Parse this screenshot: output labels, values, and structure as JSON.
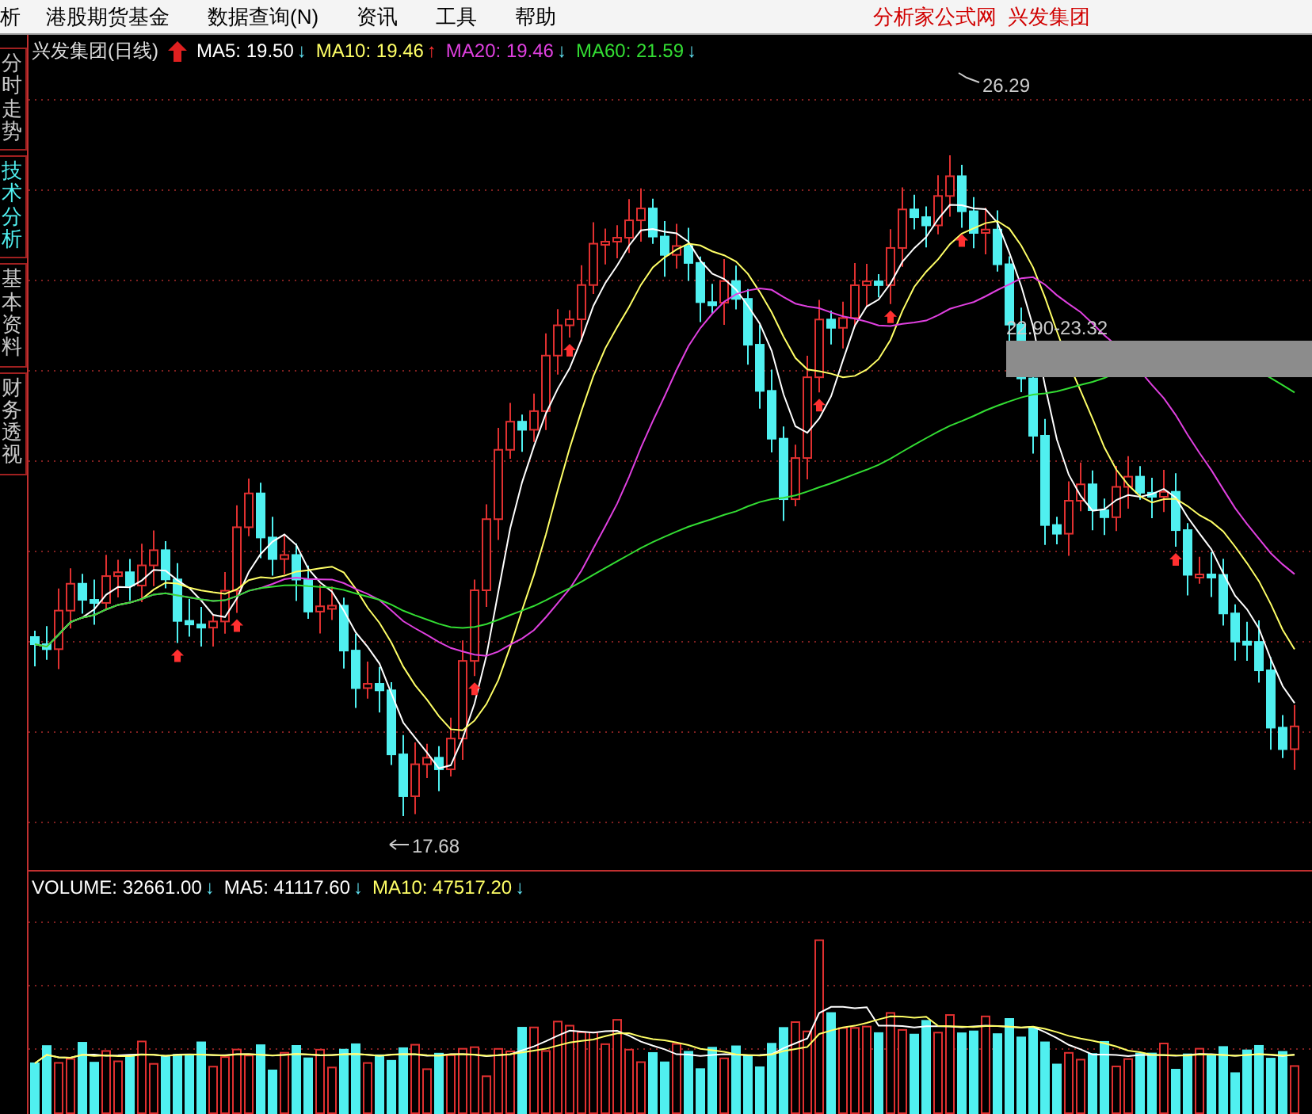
{
  "menu_bar": {
    "items": [
      {
        "label": "析"
      },
      {
        "label": "港股期货基金"
      },
      {
        "label": "数据查询(N)"
      },
      {
        "label": "资讯"
      },
      {
        "label": "工具"
      },
      {
        "label": "帮助"
      }
    ],
    "right_text": "分析家公式网  兴发集团"
  },
  "side_tabs": [
    {
      "label": "分时走势",
      "selected": false
    },
    {
      "label": "技术分析",
      "selected": true
    },
    {
      "label": "基本资料",
      "selected": false
    },
    {
      "label": "财务透视",
      "selected": false
    }
  ],
  "price_panel": {
    "title": "兴发集团(日线)",
    "indicators": [
      {
        "name": "MA5:",
        "value": "19.50",
        "arrow": "↓",
        "rising": false,
        "color": "#ffffff"
      },
      {
        "name": "MA10:",
        "value": "19.46",
        "arrow": "↑",
        "rising": true,
        "color": "#ffff66"
      },
      {
        "name": "MA20:",
        "value": "19.46",
        "arrow": "↓",
        "rising": false,
        "color": "#e040e0"
      },
      {
        "name": "MA60:",
        "value": "21.59",
        "arrow": "↓",
        "rising": false,
        "color": "#33dd33"
      }
    ],
    "high_label": "26.29",
    "low_label": "17.68",
    "range_label": "22.90-23.32"
  },
  "volume_panel": {
    "indicators": [
      {
        "name": "VOLUME:",
        "value": "32661.00",
        "arrow": "↓",
        "rising": false,
        "color": "#ffffff"
      },
      {
        "name": "MA5:",
        "value": "41117.60",
        "arrow": "↓",
        "rising": false,
        "color": "#ffffff"
      },
      {
        "name": "MA10:",
        "value": "47517.20",
        "arrow": "↓",
        "rising": false,
        "color": "#ffff66"
      }
    ]
  }
}
